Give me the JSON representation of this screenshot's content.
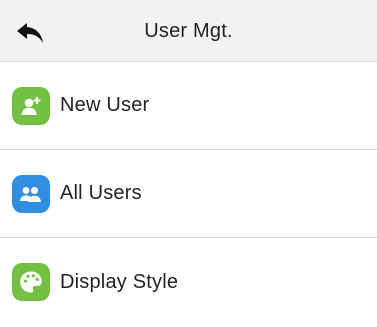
{
  "header": {
    "title": "User Mgt.",
    "back_icon": "back-arrow-icon"
  },
  "menu": {
    "items": [
      {
        "label": "New User",
        "icon": "add-user-icon",
        "icon_color": "#74c043"
      },
      {
        "label": "All Users",
        "icon": "users-icon",
        "icon_color": "#2f8ee0"
      },
      {
        "label": "Display Style",
        "icon": "palette-icon",
        "icon_color": "#74c043"
      }
    ]
  },
  "colors": {
    "header_bg": "#f2f2f2",
    "divider": "#d6d6d6",
    "text": "#222222"
  }
}
